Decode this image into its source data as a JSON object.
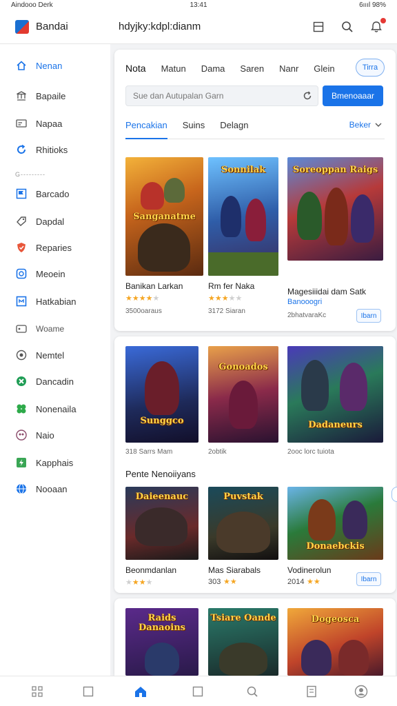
{
  "status_bar": {
    "left": "Aindooo Derk",
    "time": "13:41",
    "battery": "6ıııl 98%"
  },
  "app_bar": {
    "app_name": "Bandai",
    "subtitle": "hdyjky:kdpl:dianm"
  },
  "sidebar": {
    "items": [
      {
        "label": "Nenan",
        "icon": "home-icon",
        "active": true
      },
      {
        "label": "Bapaile",
        "icon": "bank-icon"
      },
      {
        "label": "Napaa",
        "icon": "card-icon"
      },
      {
        "label": "Rhitioks",
        "icon": "refresh-icon"
      },
      {
        "label": "Barcado",
        "icon": "flag-icon"
      },
      {
        "label": "Dapdal",
        "icon": "tag-icon"
      },
      {
        "label": "Reparies",
        "icon": "shield-icon"
      },
      {
        "label": "Meoein",
        "icon": "chat-icon"
      },
      {
        "label": "Hatkabian",
        "icon": "badge-icon"
      },
      {
        "label": "Woame",
        "icon": "gamepad-icon"
      },
      {
        "label": "Nemtel",
        "icon": "compass-icon"
      },
      {
        "label": "Dancadin",
        "icon": "cross-icon"
      },
      {
        "label": "Nonenaila",
        "icon": "leaf-icon"
      },
      {
        "label": "Naio",
        "icon": "people-icon"
      },
      {
        "label": "Kapphais",
        "icon": "bolt-icon"
      },
      {
        "label": "Nooaan",
        "icon": "globe-icon"
      }
    ],
    "separator": "G---------"
  },
  "top_tabs": [
    "Nota",
    "Matun",
    "Dama",
    "Saren",
    "Nanr",
    "Glein"
  ],
  "pill_label": "Tirra",
  "search": {
    "placeholder": "Sue dan Autupalan Garn",
    "button": "Bmenoaaar"
  },
  "sub_tabs": [
    "Pencakian",
    "Suins",
    "Delagn"
  ],
  "sort_label": "Beker",
  "colors": {
    "accent": "#1a73e8",
    "star": "#f5a623"
  },
  "section1": {
    "games": [
      {
        "name": "Banikan Larkan",
        "meta": "3500oaraus",
        "rating": 4,
        "thumb_title": "Sanganatme"
      },
      {
        "name": "Rm fer Naka",
        "meta": "3172 Siaran",
        "rating": 3,
        "thumb_title": "Sonnilak"
      },
      {
        "name": "Magesiiidai dam Satk",
        "tag": "Banooogri",
        "meta": "2bhatvaraKc",
        "install": "Ibarn",
        "thumb_title": "Soreoppan Raigs"
      }
    ]
  },
  "section2": {
    "games": [
      {
        "meta": "318 Sarrs Mam",
        "thumb_title": "Sunggco"
      },
      {
        "meta": "2obtik",
        "thumb_title": "Gonoados"
      },
      {
        "meta": "2ooc lorc tuiota",
        "thumb_title": "Dadaneurs"
      }
    ],
    "title": "Pente Nenoiiyans",
    "games2": [
      {
        "name": "Beonmdanlan",
        "rating": 3,
        "thumb_title": "Daieenauc"
      },
      {
        "name": "Mas Siarabals",
        "meta": "303",
        "rating": 2,
        "thumb_title": "Puvstak"
      },
      {
        "name": "Vodinerolun",
        "meta": "2014",
        "rating": 2,
        "install": "Ibarn",
        "thumb_title": "Donaebckis"
      }
    ]
  },
  "section3": {
    "thumbs": [
      "Raids Danaoins",
      "Tsiare Oande",
      "Dogeosca"
    ]
  },
  "bottom_nav": [
    {
      "icon": "grid-icon"
    },
    {
      "icon": "square-icon"
    },
    {
      "icon": "home-icon",
      "active": true
    },
    {
      "icon": "square-icon"
    },
    {
      "icon": "search-icon"
    },
    {
      "icon": "book-icon"
    },
    {
      "icon": "profile-icon"
    }
  ]
}
